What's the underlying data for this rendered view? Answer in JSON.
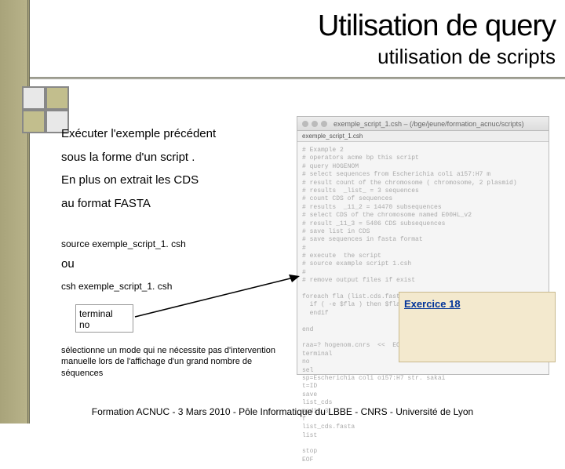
{
  "title": "Utilisation de query",
  "subtitle": "utilisation de scripts",
  "body": {
    "l1": "Exécuter l'exemple précédent",
    "l2": "sous la forme d'un script .",
    "l3": "En plus on extrait les CDS",
    "l4": "au format FASTA"
  },
  "cmd1": "source exemple_script_1. csh",
  "ou": "ou",
  "cmd2": "csh exemple_script_1. csh",
  "terminal": {
    "l1": "terminal",
    "l2": "no"
  },
  "note": "sélectionne un mode qui ne nécessite pas d'intervention manuelle lors de l'affichage d'un grand nombre de séquences",
  "exercise": "Exercice 18",
  "footer": "Formation ACNUC - 3 Mars 2010 - Pôle Informatique du LBBE - CNRS - Université de Lyon",
  "screenshot": {
    "winTitle": "exemple_script_1.csh – (/bge/jeune/formation_acnuc/scripts)",
    "tab1": "exemple_script_1.csh",
    "code": "# Example 2\n# operators acme bp this script\n# query HOGENOM\n# select sequences from Escherichia coli a157:H7 m\n# result count of the chromosome ( chromosome, 2 plasmid)\n# results  _list_ = 3 sequences\n# count CDS of sequences\n# results  _11_2 = 14470 subsequences\n# select CDS of the chromosome named E00HL_v2\n# result _11_3 = 5406 CDS subsequences\n# save list in CDS\n# save sequences in fasta format\n#\n# execute  the script\n# source example script 1.csh\n#\n# remove output files if exist\n\nforeach fla (list.cds.fasta lis _cds)\n  if ( -e $fla ) then $fla\n  endif\n\nend\n\nraa=? hogenom.cnrs  <<  EOF\nterminal\nno\nsel\nsp=Escherichia coli o157:H7 str. sakai\nt=ID\nsave\nlist_cds\nmod11_3\nf\nlist_cds.fasta\nlist\n\nstop\nEOF"
  }
}
